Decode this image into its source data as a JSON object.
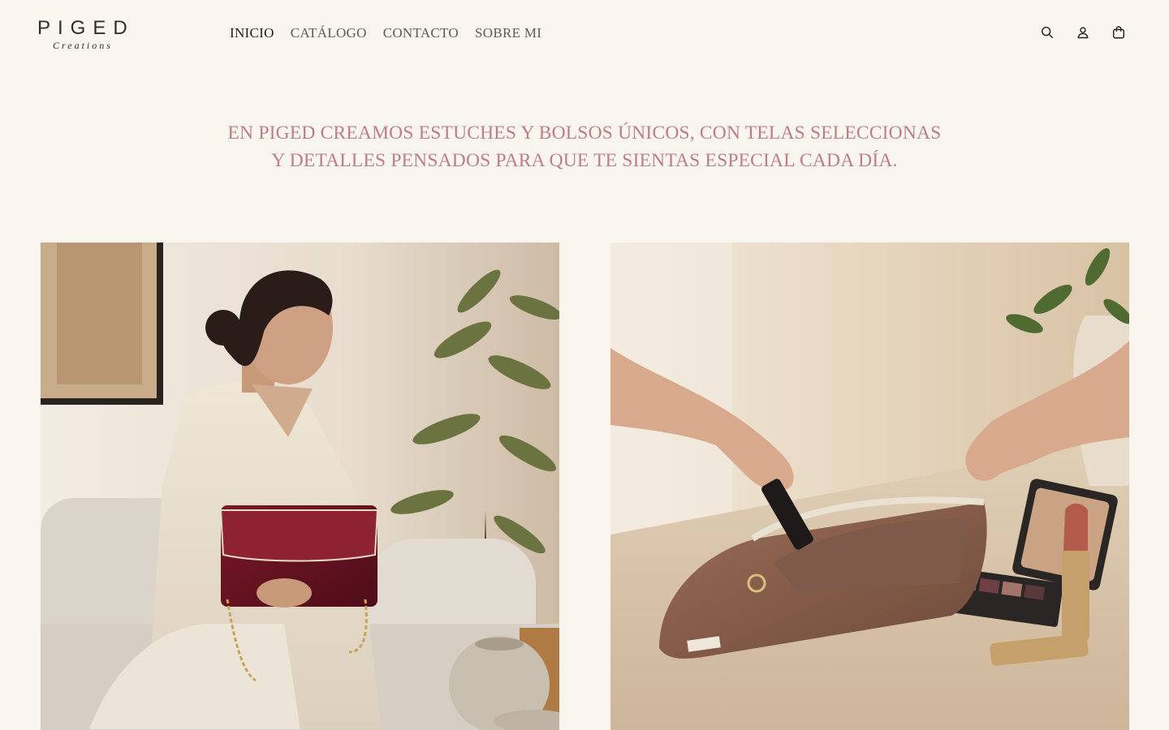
{
  "brand": {
    "name": "PIGED",
    "subtitle": "Creations"
  },
  "nav": {
    "items": [
      {
        "label": "INICIO",
        "active": true
      },
      {
        "label": "CATÁLOGO",
        "active": false
      },
      {
        "label": "CONTACTO",
        "active": false
      },
      {
        "label": "SOBRE MI",
        "active": false
      }
    ]
  },
  "header_icons": [
    "search-icon",
    "account-icon",
    "cart-icon"
  ],
  "hero": {
    "tagline_line1": "EN PIGED CREAMOS ESTUCHES Y BOLSOS ÚNICOS, CON TELAS SELECCIONAS",
    "tagline_line2": "Y DETALLES PENSADOS PARA QUE TE SIENTAS ESPECIAL CADA DÍA."
  },
  "colors": {
    "background": "#f8f5ee",
    "tagline": "#c07d86",
    "text": "#2b2b2b"
  }
}
